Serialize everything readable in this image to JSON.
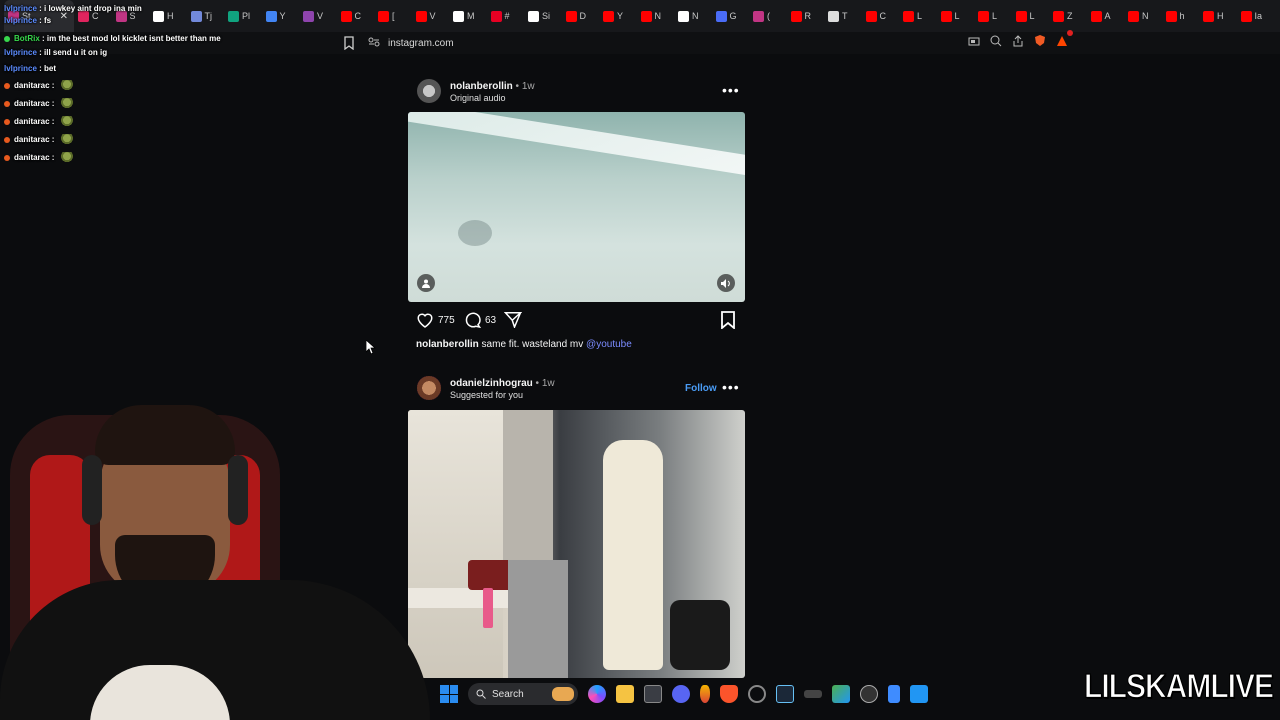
{
  "browser": {
    "url": "instagram.com",
    "active_tab": {
      "label": "St",
      "close": "✕"
    },
    "tabs": [
      {
        "label": "C",
        "color": "#e0245e"
      },
      {
        "label": "S",
        "color": "#c13584"
      },
      {
        "label": "H",
        "color": "#ffffff"
      },
      {
        "label": "Tj",
        "color": "#7289da"
      },
      {
        "label": "Pl",
        "color": "#10a37f"
      },
      {
        "label": "Y",
        "color": "#4285f4"
      },
      {
        "label": "V",
        "color": "#8e44ad"
      },
      {
        "label": "C",
        "color": "#ff0000"
      },
      {
        "label": "[",
        "color": "#ff0000"
      },
      {
        "label": "V",
        "color": "#ff0000"
      },
      {
        "label": "M",
        "color": "#ffffff"
      },
      {
        "label": "#",
        "color": "#e60023"
      },
      {
        "label": "Si",
        "color": "#ffffff"
      },
      {
        "label": "D",
        "color": "#ff0000"
      },
      {
        "label": "Y",
        "color": "#ff0000"
      },
      {
        "label": "N",
        "color": "#ff0000"
      },
      {
        "label": "N",
        "color": "#ffffff"
      },
      {
        "label": "G",
        "color": "#4a6cf7"
      },
      {
        "label": "(",
        "color": "#c13584"
      },
      {
        "label": "R",
        "color": "#ff0000"
      },
      {
        "label": "T",
        "color": "#dddddd"
      },
      {
        "label": "C",
        "color": "#ff0000"
      },
      {
        "label": "L",
        "color": "#ff0000"
      },
      {
        "label": "L",
        "color": "#ff0000"
      },
      {
        "label": "L",
        "color": "#ff0000"
      },
      {
        "label": "L",
        "color": "#ff0000"
      },
      {
        "label": "Z",
        "color": "#ff0000"
      },
      {
        "label": "A",
        "color": "#ff0000"
      },
      {
        "label": "N",
        "color": "#ff0000"
      },
      {
        "label": "h",
        "color": "#ff0000"
      },
      {
        "label": "H",
        "color": "#ff0000"
      },
      {
        "label": "Ia",
        "color": "#ff0000"
      }
    ]
  },
  "chat": [
    {
      "user": "lvlprince",
      "sep": " : ",
      "msg": "i lowkey aint drop ina min",
      "color": "#5c8cff",
      "badge": ""
    },
    {
      "user": "lvlprince",
      "sep": " : ",
      "msg": "fs",
      "color": "#5c8cff",
      "badge": ""
    },
    {
      "user": "BotRix",
      "sep": " : ",
      "msg": "im the best mod lol kicklet isnt better than me",
      "color": "#38d94d",
      "badge": "#38d94d"
    },
    {
      "user": "lvlprince",
      "sep": " : ",
      "msg": "ill send u it on ig",
      "color": "#5c8cff",
      "badge": ""
    },
    {
      "user": "lvlprince",
      "sep": " : ",
      "msg": "bet",
      "color": "#5c8cff",
      "badge": ""
    },
    {
      "user": "danitarac",
      "sep": " : ",
      "msg": "",
      "color": "#ffffff",
      "badge": "#e85a1e"
    },
    {
      "user": "danitarac",
      "sep": " : ",
      "msg": "",
      "color": "#ffffff",
      "badge": "#e85a1e"
    },
    {
      "user": "danitarac",
      "sep": " : ",
      "msg": "",
      "color": "#ffffff",
      "badge": "#e85a1e"
    },
    {
      "user": "danitarac",
      "sep": " : ",
      "msg": "",
      "color": "#ffffff",
      "badge": "#e85a1e"
    },
    {
      "user": "danitarac",
      "sep": " : ",
      "msg": "",
      "color": "#ffffff",
      "badge": "#e85a1e"
    }
  ],
  "posts": [
    {
      "username": "nolanberollin",
      "time": " • 1w",
      "subtitle": "Original audio",
      "likes": "775",
      "comments": "63",
      "caption_user": "nolanberollin",
      "caption_text": " same fit. wasteland mv ",
      "caption_mention": "@youtube"
    },
    {
      "username": "odanielzinhograu",
      "time": " • 1w",
      "subtitle": "Suggested for you",
      "follow": "Follow"
    }
  ],
  "taskbar": {
    "search_label": "Search"
  },
  "watermark": "LILSKAMLIVE"
}
